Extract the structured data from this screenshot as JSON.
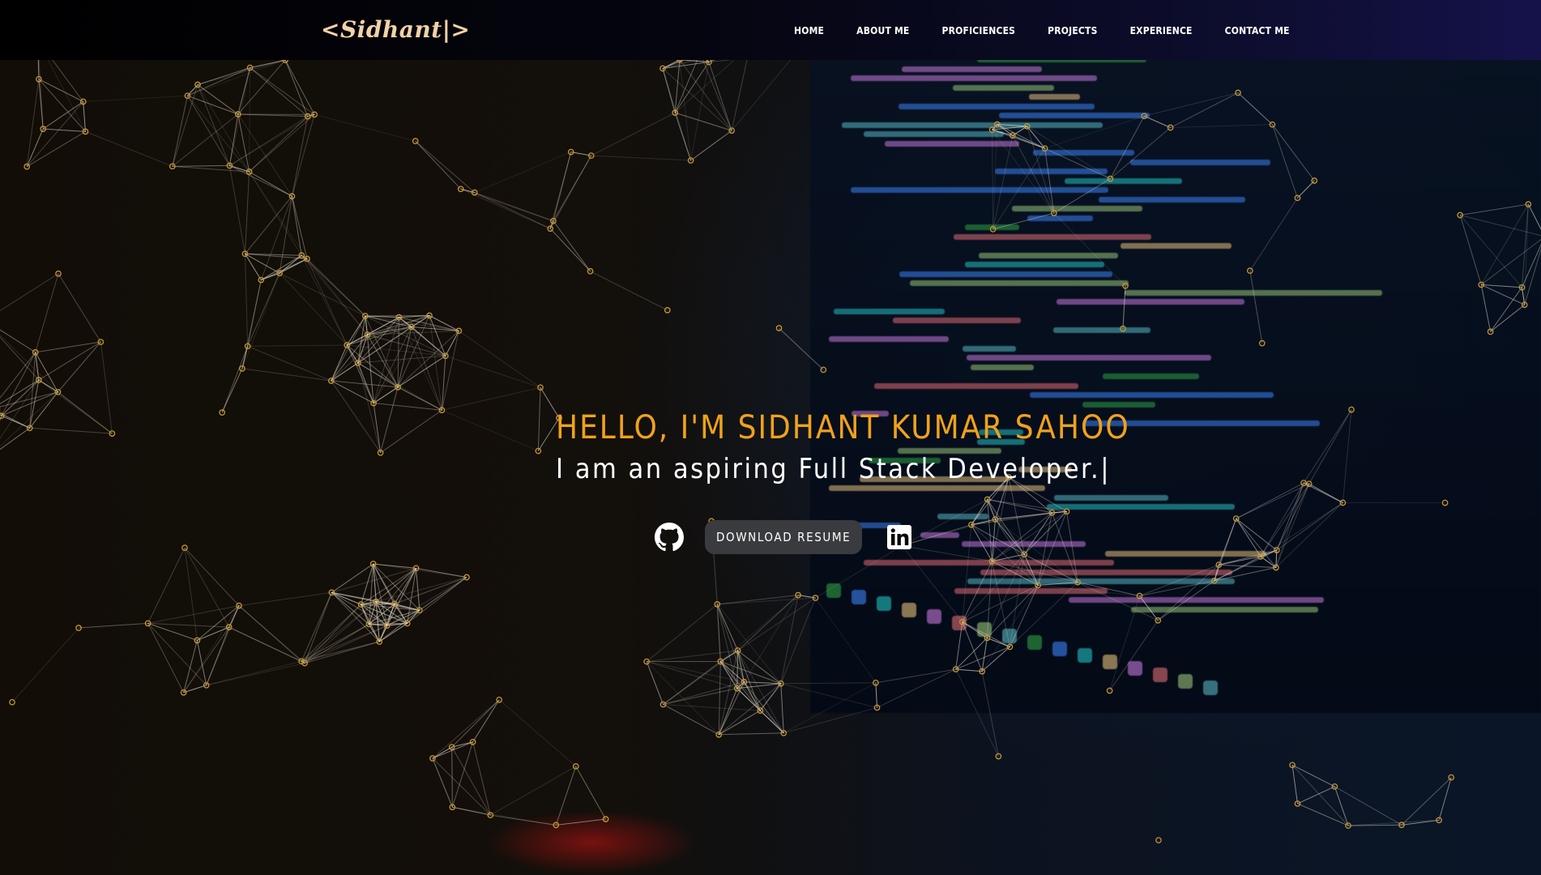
{
  "navbar": {
    "brand": "<Sidhant|>",
    "links": [
      {
        "label": "HOME"
      },
      {
        "label": "ABOUT ME"
      },
      {
        "label": "PROFICIENCES"
      },
      {
        "label": "PROJECTS"
      },
      {
        "label": "EXPERIENCE"
      },
      {
        "label": "CONTACT ME"
      }
    ]
  },
  "hero": {
    "greeting": "HELLO, I'M SIDHANT KUMAR SAHOO",
    "subtitle": "I am an aspiring Full Stack Developer.",
    "caret": "|",
    "resume_label": "DOWNLOAD RESUME",
    "icons": [
      "github-icon",
      "linkedin-icon"
    ]
  },
  "colors": {
    "accent": "#f0a21a",
    "node": "#c8962e",
    "link": "#e8e2d2",
    "button_bg": "#3a3b3f"
  }
}
